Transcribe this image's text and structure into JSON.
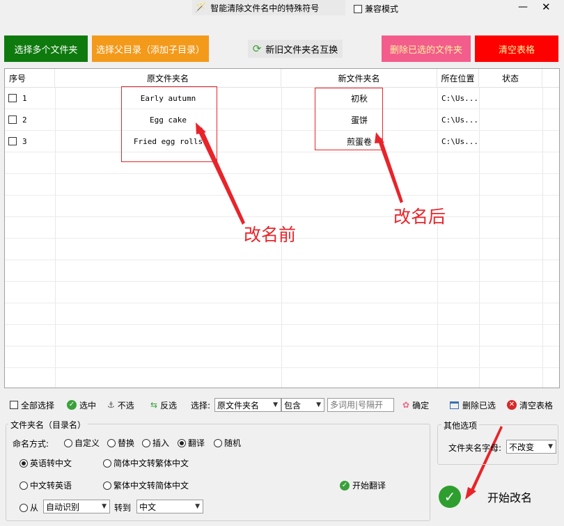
{
  "title": "智能清除文件名中的特殊符号",
  "compat_label": "兼容模式",
  "buttons": {
    "select_folders": "选择多个文件夹",
    "select_parent": "选择父目录（添加子目录）",
    "swap": "新旧文件夹名互换",
    "delete_selected": "删除已选的文件夹",
    "clear_table": "清空表格"
  },
  "table": {
    "headers": [
      "序号",
      "原文件夹名",
      "新文件夹名",
      "所在位置",
      "状态"
    ],
    "rows": [
      {
        "no": "1",
        "old": "Early autumn",
        "new": "初秋",
        "path": "C:\\Us..."
      },
      {
        "no": "2",
        "old": "Egg cake",
        "new": "蛋饼",
        "path": "C:\\Us..."
      },
      {
        "no": "3",
        "old": "Fried egg rolls",
        "new": "煎蛋卷",
        "path": "C:\\Us..."
      }
    ]
  },
  "annotations": {
    "before": "改名前",
    "after": "改名后"
  },
  "toolbar": {
    "select_all": "全部选择",
    "check": "选中",
    "uncheck": "不选",
    "invert": "反选",
    "select_label": "选择:",
    "field_value": "原文件夹名",
    "match_value": "包含",
    "keyword_placeholder": "多词用|号隔开",
    "confirm": "确定",
    "delete_selected": "删除已选",
    "clear": "清空表格"
  },
  "folder_group": {
    "title": "文件夹名（目录名）",
    "naming_label": "命名方式:",
    "modes": [
      "自定义",
      "替换",
      "插入",
      "翻译",
      "随机"
    ],
    "selected_mode": "翻译",
    "opt_en_cn": "英语转中文",
    "opt_s_t": "简体中文转繁体中文",
    "opt_cn_en": "中文转英语",
    "opt_t_s": "繁体中文转简体中文",
    "start_translate": "开始翻译",
    "from_label": "从",
    "from_value": "自动识别",
    "to_label": "转到",
    "to_value": "中文"
  },
  "other_group": {
    "title": "其他选项",
    "case_label": "文件夹名字母:",
    "case_value": "不改变"
  },
  "start_rename": "开始改名",
  "colors": {
    "green": "#0e7a0e",
    "orange": "#f39a1b",
    "pink": "#f35d8c",
    "red": "#ff0000",
    "annotation": "#e8242a"
  }
}
